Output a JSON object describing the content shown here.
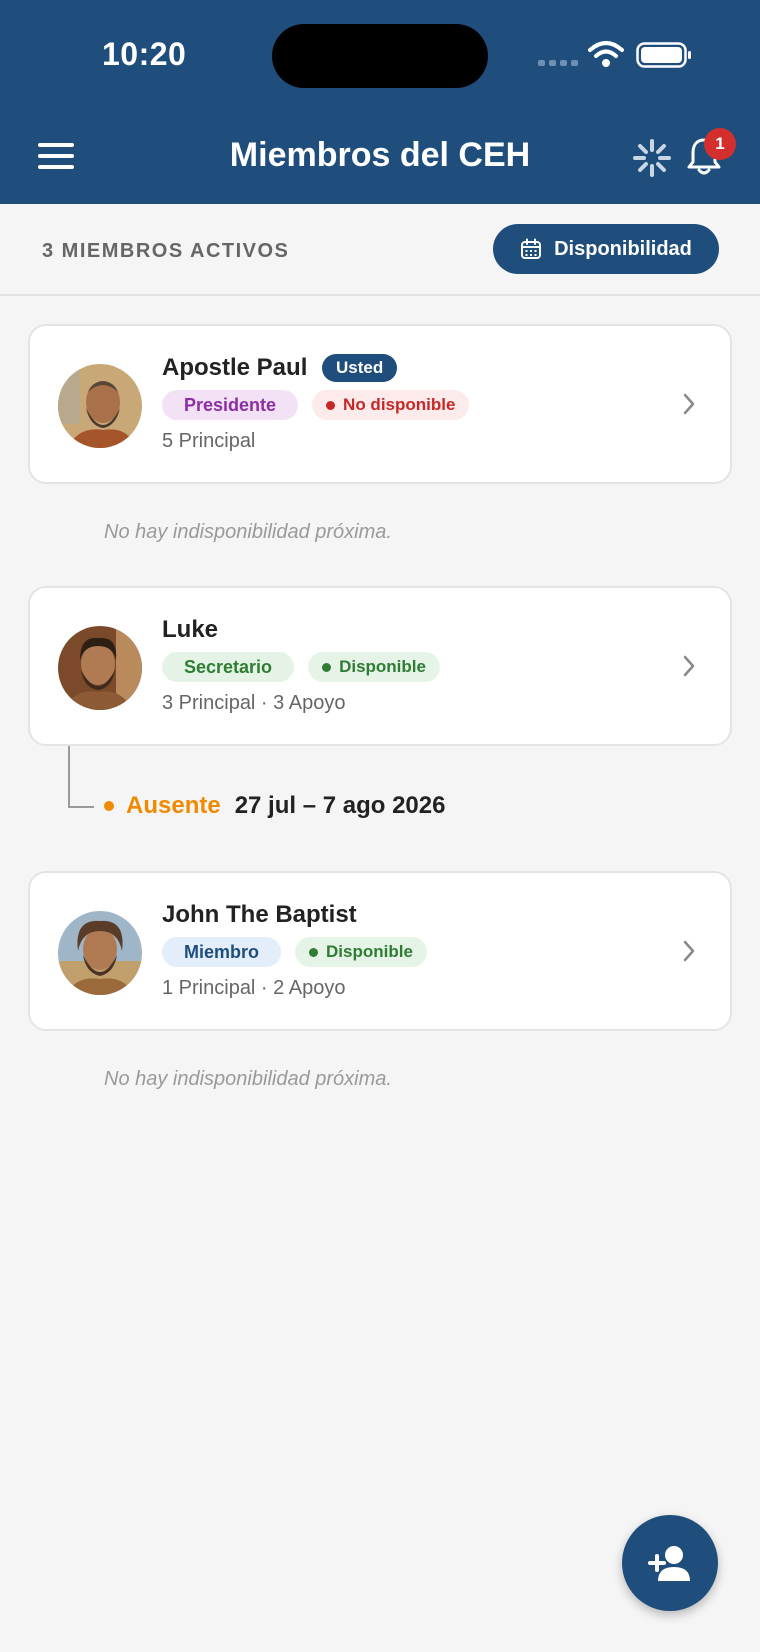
{
  "status_bar": {
    "time": "10:20"
  },
  "header": {
    "title": "Miembros del CEH",
    "notifications_count": "1"
  },
  "subheader": {
    "member_count": "3 MIEMBROS ACTIVOS",
    "availability_button": "Disponibilidad"
  },
  "members": [
    {
      "name": "Apostle Paul",
      "you_label": "Usted",
      "role": "Presidente",
      "status": "No disponible",
      "counts": "5 Principal",
      "note": "No hay indisponibilidad próxima."
    },
    {
      "name": "Luke",
      "role": "Secretario",
      "status": "Disponible",
      "counts": "3 Principal · 3 Apoyo",
      "absence": {
        "label": "Ausente",
        "range": "27 jul – 7 ago 2026"
      }
    },
    {
      "name": "John The Baptist",
      "role": "Miembro",
      "status": "Disponible",
      "counts": "1 Principal · 2 Apoyo",
      "note": "No hay indisponibilidad próxima."
    }
  ],
  "colors": {
    "primary": "#1f4e7d",
    "unavailable": "#c62828",
    "available": "#2e7d32",
    "absent": "#f08a00"
  },
  "icons": [
    "menu-icon",
    "sync-icon",
    "bell-icon",
    "calendar-icon",
    "chevron-right-icon",
    "add-user-icon"
  ]
}
